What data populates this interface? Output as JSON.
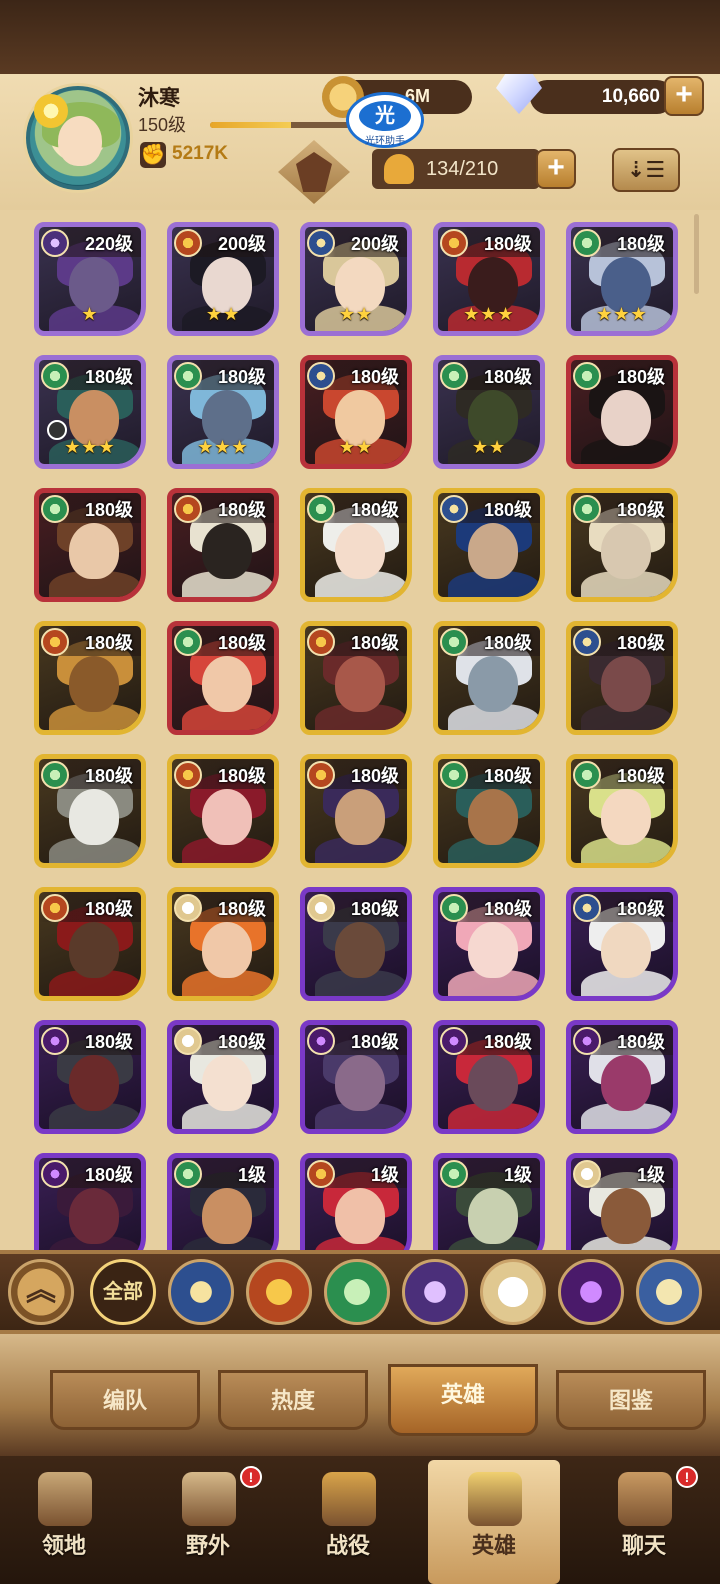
{
  "player": {
    "name": "沐寒",
    "level": "150级",
    "xp_fraction": 0.58,
    "power": "5217K"
  },
  "currency": {
    "gold": "6M",
    "gems": "10,660"
  },
  "overlay_badge": {
    "char": "光",
    "label": "光环助手"
  },
  "hero_count": "134/210",
  "colors": {
    "gold_border": "#e2b531",
    "red_border": "#b8323a",
    "purple_border": "#9b6fd4",
    "violet_border": "#7a39c7",
    "accent": "#b47b15"
  },
  "heroes": [
    {
      "level": "220级",
      "faction": "graveborn",
      "frame": "purple",
      "stars": "★",
      "hair": "#5c3a88",
      "skin": "#6b5a8a"
    },
    {
      "level": "200级",
      "faction": "mauler",
      "frame": "purple",
      "stars": "★★",
      "hair": "#1c1a24",
      "skin": "#e9d8d0"
    },
    {
      "level": "200级",
      "faction": "lightbearer",
      "frame": "purple",
      "stars": "★★",
      "hair": "#d9c79a",
      "skin": "#f3d9c0"
    },
    {
      "level": "180级",
      "faction": "mauler",
      "frame": "purple",
      "stars": "★★★",
      "hair": "#b82a30",
      "skin": "#3a1c1c"
    },
    {
      "level": "180级",
      "faction": "wilder",
      "frame": "purple",
      "stars": "★★★",
      "hair": "#b7c2d9",
      "skin": "#4a5f8a"
    },
    {
      "level": "180级",
      "faction": "wilder",
      "frame": "purple",
      "stars": "★★★",
      "hair": "#2a5e5a",
      "skin": "#c98f62",
      "clock": true
    },
    {
      "level": "180级",
      "faction": "wilder",
      "frame": "purple",
      "stars": "★★★",
      "hair": "#7fb7d9",
      "skin": "#5e6f8a"
    },
    {
      "level": "180级",
      "faction": "lightbearer",
      "frame": "red",
      "stars": "★★",
      "hair": "#c9472f",
      "skin": "#f0c9a0"
    },
    {
      "level": "180级",
      "faction": "wilder",
      "frame": "purple",
      "stars": "★★",
      "hair": "#2e2a24",
      "skin": "#3e4a2a"
    },
    {
      "level": "180级",
      "faction": "wilder",
      "frame": "red",
      "stars": "",
      "hair": "#1a1414",
      "skin": "#e8d2c8"
    },
    {
      "level": "180级",
      "faction": "wilder",
      "frame": "red",
      "stars": "",
      "hair": "#6e4128",
      "skin": "#e9c8a8"
    },
    {
      "level": "180级",
      "faction": "mauler",
      "frame": "red",
      "stars": "",
      "hair": "#e8e2d0",
      "skin": "#2a2420"
    },
    {
      "level": "180级",
      "faction": "wilder",
      "frame": "gold",
      "stars": "",
      "hair": "#eeeeea",
      "skin": "#f4dccb"
    },
    {
      "level": "180级",
      "faction": "lightbearer",
      "frame": "gold",
      "stars": "",
      "hair": "#1c3a7a",
      "skin": "#c9a88a"
    },
    {
      "level": "180级",
      "faction": "wilder",
      "frame": "gold",
      "stars": "",
      "hair": "#e8dcc0",
      "skin": "#d8c8b0"
    },
    {
      "level": "180级",
      "faction": "mauler",
      "frame": "gold",
      "stars": "",
      "hair": "#c98f3a",
      "skin": "#8a5a2a"
    },
    {
      "level": "180级",
      "faction": "wilder",
      "frame": "red",
      "stars": "",
      "hair": "#d6453a",
      "skin": "#f0c8a8"
    },
    {
      "level": "180级",
      "faction": "mauler",
      "frame": "gold",
      "stars": "",
      "hair": "#6a2a2a",
      "skin": "#a8584a"
    },
    {
      "level": "180级",
      "faction": "wilder",
      "frame": "gold",
      "stars": "",
      "hair": "#dfe2e8",
      "skin": "#8a9aa8"
    },
    {
      "level": "180级",
      "faction": "lightbearer",
      "frame": "gold",
      "stars": "",
      "hair": "#3a2a30",
      "skin": "#7a4a4a"
    },
    {
      "level": "180级",
      "faction": "wilder",
      "frame": "gold",
      "stars": "",
      "hair": "#8a8a80",
      "skin": "#e8e8e2"
    },
    {
      "level": "180级",
      "faction": "mauler",
      "frame": "gold",
      "stars": "",
      "hair": "#8a1a2a",
      "skin": "#f0c0b8"
    },
    {
      "level": "180级",
      "faction": "mauler",
      "frame": "gold",
      "stars": "",
      "hair": "#3a2a5a",
      "skin": "#c99f7a"
    },
    {
      "level": "180级",
      "faction": "wilder",
      "frame": "gold",
      "stars": "",
      "hair": "#2a5e5a",
      "skin": "#a8744a"
    },
    {
      "level": "180级",
      "faction": "wilder",
      "frame": "gold",
      "stars": "",
      "hair": "#d9e08a",
      "skin": "#f4d8c0"
    },
    {
      "level": "180级",
      "faction": "mauler",
      "frame": "gold",
      "stars": "",
      "hair": "#8a1a1a",
      "skin": "#5a3a2a"
    },
    {
      "level": "180级",
      "faction": "celestial",
      "frame": "gold",
      "stars": "",
      "hair": "#e8732a",
      "skin": "#f0c8a8"
    },
    {
      "level": "180级",
      "faction": "celestial",
      "frame": "violet",
      "stars": "",
      "hair": "#3a3a4a",
      "skin": "#6a4a3a"
    },
    {
      "level": "180级",
      "faction": "wilder",
      "frame": "violet",
      "stars": "",
      "hair": "#f0a8b8",
      "skin": "#f6d8d0"
    },
    {
      "level": "180级",
      "faction": "lightbearer",
      "frame": "violet",
      "stars": "",
      "hair": "#eeeeee",
      "skin": "#f0d8c0"
    },
    {
      "level": "180级",
      "faction": "hypogean",
      "frame": "violet",
      "stars": "",
      "hair": "#3a3a44",
      "skin": "#6a2a2a"
    },
    {
      "level": "180级",
      "faction": "celestial",
      "frame": "violet",
      "stars": "",
      "hair": "#e8e8e0",
      "skin": "#f4e0d0"
    },
    {
      "level": "180级",
      "faction": "hypogean",
      "frame": "violet",
      "stars": "",
      "hair": "#4a3a6a",
      "skin": "#8a6a8a"
    },
    {
      "level": "180级",
      "faction": "hypogean",
      "frame": "violet",
      "stars": "",
      "hair": "#c8283a",
      "skin": "#6a4a5a"
    },
    {
      "level": "180级",
      "faction": "hypogean",
      "frame": "violet",
      "stars": "",
      "hair": "#e0e0e8",
      "skin": "#9a3a6a"
    },
    {
      "level": "180级",
      "faction": "hypogean",
      "frame": "violet",
      "stars": "",
      "hair": "#3a1a3a",
      "skin": "#6a2a3a"
    },
    {
      "level": "1级",
      "faction": "wilder",
      "frame": "violet",
      "stars": "",
      "hair": "#2a2a3a",
      "skin": "#c98f62"
    },
    {
      "level": "1级",
      "faction": "mauler",
      "frame": "violet",
      "stars": "",
      "hair": "#c8283a",
      "skin": "#f0c0a8"
    },
    {
      "level": "1级",
      "faction": "wilder",
      "frame": "violet",
      "stars": "",
      "hair": "#3a4a3a",
      "skin": "#c8d0b0"
    },
    {
      "level": "1级",
      "faction": "celestial",
      "frame": "violet",
      "stars": "",
      "hair": "#e8e8e0",
      "skin": "#8a5a3a"
    }
  ],
  "filters": {
    "up_icon": "double-chevron-up-icon",
    "all_label": "全部",
    "factions": [
      "lightbearer",
      "mauler",
      "wilder",
      "graveborn",
      "celestial",
      "hypogean",
      "dimensional"
    ]
  },
  "subtabs": [
    {
      "label": "编队",
      "active": false
    },
    {
      "label": "热度",
      "active": false
    },
    {
      "label": "英雄",
      "active": true
    },
    {
      "label": "图鉴",
      "active": false
    }
  ],
  "nav": [
    {
      "label": "领地",
      "icon": "castle-icon",
      "active": false,
      "badge": ""
    },
    {
      "label": "野外",
      "icon": "map-scroll-icon",
      "active": false,
      "badge": "!"
    },
    {
      "label": "战役",
      "icon": "sword-shield-icon",
      "active": false,
      "badge": ""
    },
    {
      "label": "英雄",
      "icon": "helmet-icon",
      "active": true,
      "badge": ""
    },
    {
      "label": "聊天",
      "icon": "chat-bubble-icon",
      "active": false,
      "badge": "!"
    }
  ]
}
